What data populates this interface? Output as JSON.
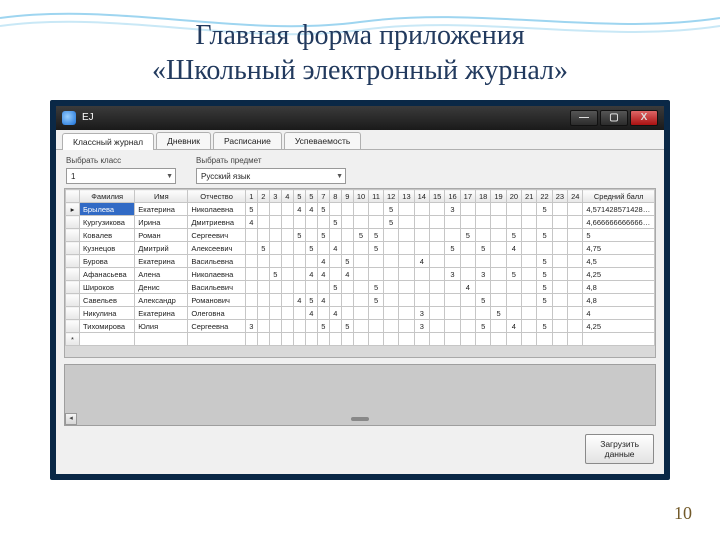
{
  "slide": {
    "title_line1": "Главная форма приложения",
    "title_line2": "«Школьный электронный журнал»",
    "page_number": "10"
  },
  "window": {
    "icon_label": "EJ",
    "min": "—",
    "max": "▢",
    "close": "X"
  },
  "tabs": [
    {
      "label": "Классный журнал",
      "active": true
    },
    {
      "label": "Дневник",
      "active": false
    },
    {
      "label": "Расписание",
      "active": false
    },
    {
      "label": "Успеваемость",
      "active": false
    }
  ],
  "filters": {
    "class_label": "Выбрать класс",
    "class_value": "1",
    "subject_label": "Выбрать предмет",
    "subject_value": "Русский язык"
  },
  "grid": {
    "headers": {
      "surname": "Фамилия",
      "name": "Имя",
      "patronymic": "Отчество",
      "days": [
        "1",
        "2",
        "3",
        "4",
        "5",
        "5",
        "7",
        "8",
        "9",
        "10",
        "11",
        "12",
        "13",
        "14",
        "15",
        "16",
        "17",
        "18",
        "19",
        "20",
        "21",
        "22",
        "23",
        "24"
      ],
      "avg": "Средний балл"
    },
    "rows": [
      {
        "rh": "▸",
        "surname": "Брылева",
        "name": "Екатерина",
        "patronymic": "Николаевна",
        "selected": true,
        "marks": {
          "1": "5",
          "5": "4",
          "6": "4",
          "7": "5",
          "12": "5",
          "16": "3",
          "22": "5"
        },
        "avg": "4,571428571428…"
      },
      {
        "rh": "",
        "surname": "Кургузикова",
        "name": "Ирина",
        "patronymic": "Дмитриевна",
        "marks": {
          "1": "4",
          "8": "5",
          "12": "5"
        },
        "avg": "4,666666666666…"
      },
      {
        "rh": "",
        "surname": "Ковалев",
        "name": "Роман",
        "patronymic": "Сергеевич",
        "marks": {
          "5": "5",
          "7": "5",
          "10": "5",
          "11": "5",
          "17": "5",
          "20": "5",
          "22": "5"
        },
        "avg": "5"
      },
      {
        "rh": "",
        "surname": "Кузнецов",
        "name": "Дмитрий",
        "patronymic": "Алексеевич",
        "marks": {
          "2": "5",
          "6": "5",
          "8": "4",
          "11": "5",
          "16": "5",
          "18": "5",
          "20": "4"
        },
        "avg": "4,75"
      },
      {
        "rh": "",
        "surname": "Бурова",
        "name": "Екатерина",
        "patronymic": "Васильевна",
        "marks": {
          "7": "4",
          "9": "5",
          "14": "4",
          "22": "5"
        },
        "avg": "4,5"
      },
      {
        "rh": "",
        "surname": "Афанасьева",
        "name": "Алена",
        "patronymic": "Николаевна",
        "marks": {
          "3": "5",
          "6": "4",
          "7": "4",
          "9": "4",
          "16": "3",
          "18": "3",
          "20": "5",
          "22": "5"
        },
        "avg": "4,25"
      },
      {
        "rh": "",
        "surname": "Широков",
        "name": "Денис",
        "patronymic": "Васильевич",
        "marks": {
          "8": "5",
          "11": "5",
          "17": "4",
          "22": "5"
        },
        "avg": "4,8"
      },
      {
        "rh": "",
        "surname": "Савельев",
        "name": "Александр",
        "patronymic": "Романович",
        "marks": {
          "5": "4",
          "6": "5",
          "7": "4",
          "11": "5",
          "18": "5",
          "22": "5"
        },
        "avg": "4,8"
      },
      {
        "rh": "",
        "surname": "Никулина",
        "name": "Екатерина",
        "patronymic": "Олеговна",
        "marks": {
          "6": "4",
          "8": "4",
          "14": "3",
          "19": "5"
        },
        "avg": "4"
      },
      {
        "rh": "",
        "surname": "Тихомирова",
        "name": "Юлия",
        "patronymic": "Сергеевна",
        "marks": {
          "1": "3",
          "7": "5",
          "9": "5",
          "14": "3",
          "18": "5",
          "20": "4",
          "22": "5"
        },
        "avg": "4,25"
      },
      {
        "rh": "*",
        "surname": "",
        "name": "",
        "patronymic": "",
        "marks": {},
        "avg": ""
      }
    ]
  },
  "load_button": "Загрузить\nданные"
}
